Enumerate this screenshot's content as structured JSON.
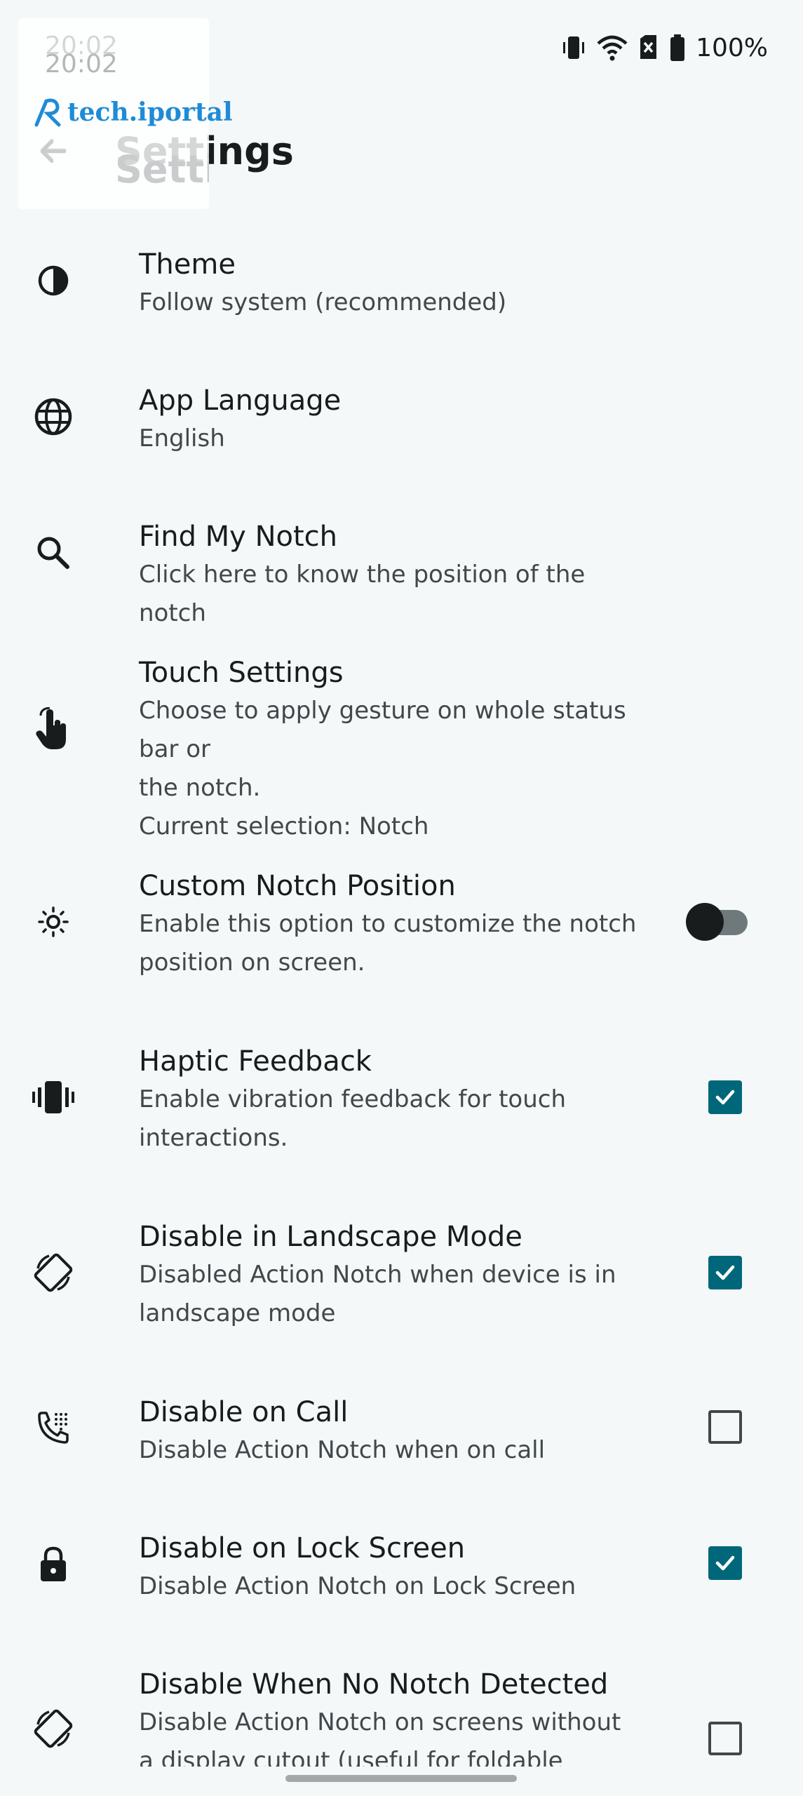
{
  "status_bar": {
    "time": "20:02",
    "battery": "100%",
    "icons": [
      "vibrate-icon",
      "wifi-icon",
      "no-sim-icon",
      "battery-icon"
    ]
  },
  "app_bar": {
    "title": "Settings",
    "back_icon": "arrow-back-icon"
  },
  "watermark": {
    "text": "tech.iportal"
  },
  "accent_color": "#00677a",
  "settings": {
    "theme": {
      "title": "Theme",
      "summary": "Follow system (recommended)",
      "icon": "contrast-icon"
    },
    "language": {
      "title": "App Language",
      "summary": "English",
      "icon": "globe-icon"
    },
    "find_notch": {
      "title": "Find My Notch",
      "summary": "Click here to know the position of the notch",
      "icon": "search-icon"
    },
    "touch": {
      "title": "Touch Settings",
      "summary_line1": "Choose to apply gesture on whole status bar or",
      "summary_line2": "the notch.",
      "summary_line3": "Current selection: Notch",
      "icon": "touch-hand-icon"
    },
    "custom_position": {
      "title": "Custom Notch Position",
      "summary_line1": "Enable this option to customize the notch",
      "summary_line2": "position on screen.",
      "icon": "brightness-icon",
      "enabled": false
    },
    "haptic": {
      "title": "Haptic Feedback",
      "summary_line1": "Enable vibration feedback for touch",
      "summary_line2": "interactions.",
      "icon": "vibration-icon",
      "checked": true
    },
    "landscape": {
      "title": "Disable in Landscape Mode",
      "summary_line1": "Disabled Action Notch when device is in",
      "summary_line2": "landscape mode",
      "icon": "screen-rotation-icon",
      "checked": true
    },
    "on_call": {
      "title": "Disable on Call",
      "summary": "Disable Action Notch when on call",
      "icon": "dialpad-phone-icon",
      "checked": false
    },
    "lock_screen": {
      "title": "Disable on Lock Screen",
      "summary": "Disable Action Notch on Lock Screen",
      "icon": "lock-icon",
      "checked": true
    },
    "no_notch": {
      "title": "Disable When No Notch Detected",
      "summary_line1": "Disable Action Notch on screens without",
      "summary_line2": "a display cutout (useful for foldable",
      "icon": "screen-rotation-icon",
      "checked": false
    }
  }
}
